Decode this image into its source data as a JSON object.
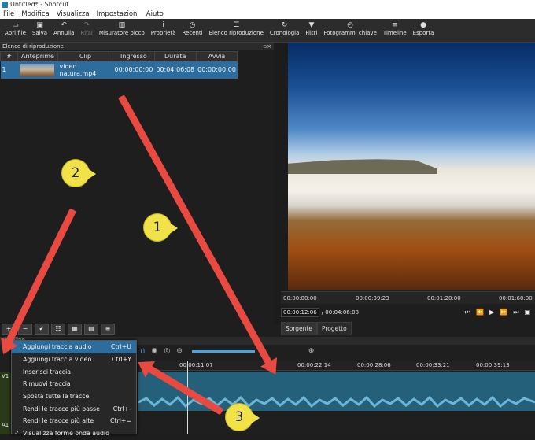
{
  "window": {
    "title": "Untitled* - Shotcut"
  },
  "menu": [
    "File",
    "Modifica",
    "Visualizza",
    "Impostazioni",
    "Aiuto"
  ],
  "toolbar": [
    {
      "icon": "folder-icon",
      "label": "Apri file",
      "enabled": true
    },
    {
      "icon": "save-icon",
      "label": "Salva",
      "enabled": true
    },
    {
      "icon": "undo-icon",
      "label": "Annulla",
      "enabled": true
    },
    {
      "icon": "redo-icon",
      "label": "Rifai",
      "enabled": false
    },
    {
      "icon": "peak-meter-icon",
      "label": "Misuratore picco",
      "enabled": true
    },
    {
      "icon": "info-icon",
      "label": "Proprietà",
      "enabled": true
    },
    {
      "icon": "clock-icon",
      "label": "Recenti",
      "enabled": true
    },
    {
      "icon": "list-icon",
      "label": "Elenco riproduzione",
      "enabled": true
    },
    {
      "icon": "history-icon",
      "label": "Cronologia",
      "enabled": true
    },
    {
      "icon": "filter-icon",
      "label": "Filtri",
      "enabled": true
    },
    {
      "icon": "keyframe-icon",
      "label": "Fotogrammi chiave",
      "enabled": true
    },
    {
      "icon": "timeline-icon",
      "label": "Timeline",
      "enabled": true
    },
    {
      "icon": "export-icon",
      "label": "Esporta",
      "enabled": true
    }
  ],
  "playlist": {
    "title": "Elenco di riproduzione",
    "columns": [
      "#",
      "Anteprime",
      "Clip",
      "Ingresso",
      "Durata",
      "Avvia"
    ],
    "rows": [
      {
        "num": "1",
        "clip": "video natura.mp4",
        "in": "00:00:00:00",
        "duration": "00:04:06:08",
        "start": "00:00:00:00"
      }
    ]
  },
  "player": {
    "ruler": [
      "00:00:00:00",
      "00:00:39:23",
      "00:01:20:00",
      "00:01:60:00"
    ],
    "current_time": "00:00:12:06",
    "total_time": "/ 00:04:06:08",
    "tabs": [
      "Sorgente",
      "Progetto"
    ]
  },
  "timeline": {
    "title": "Timeline",
    "ruler": [
      "00:00:11:07",
      "00:00:22:14",
      "00:00:28:06",
      "00:00:33:21",
      "00:00:39:13"
    ],
    "tracks": [
      "V1",
      "A1"
    ]
  },
  "context_menu": [
    {
      "label": "Aggiungi traccia audio",
      "shortcut": "Ctrl+U",
      "highlighted": true
    },
    {
      "label": "Aggiungi traccia video",
      "shortcut": "Ctrl+Y"
    },
    {
      "label": "Inserisci traccia",
      "shortcut": ""
    },
    {
      "label": "Rimuovi traccia",
      "shortcut": ""
    },
    {
      "label": "Sposta tutte le tracce",
      "shortcut": ""
    },
    {
      "label": "Rendi le tracce più basse",
      "shortcut": "Ctrl+-"
    },
    {
      "label": "Rendi le tracce più alte",
      "shortcut": "Ctrl+="
    },
    {
      "label": "Visualizza forme onda audio",
      "shortcut": "",
      "checked": true
    }
  ],
  "annotations": [
    "1",
    "2",
    "3"
  ],
  "colors": {
    "arrow": "#e84a42",
    "badge": "#f1e247",
    "selection": "#2c6d9e"
  }
}
